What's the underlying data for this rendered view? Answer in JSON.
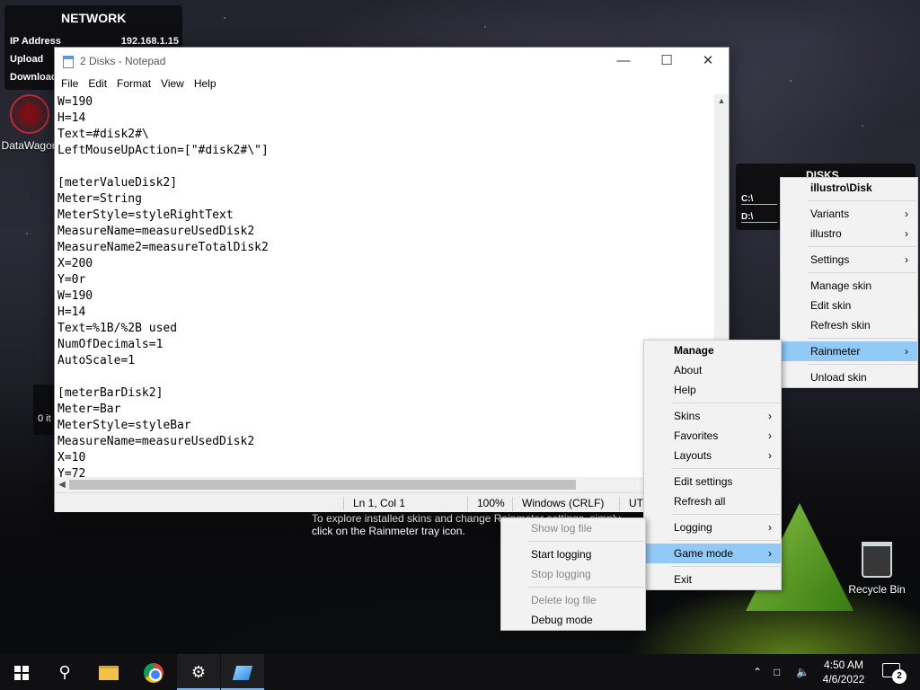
{
  "network": {
    "title": "NETWORK",
    "ip_label": "IP Address",
    "ip_value": "192.168.1.15",
    "upload_label": "Upload",
    "download_label": "Download"
  },
  "desktop": {
    "datawagon_label": "DataWagon",
    "recycle_bin_label": "Recycle Bin",
    "left_widget_text": "0 it"
  },
  "disks": {
    "title": "DISKS",
    "c_label": "C:\\",
    "d_label": "D:\\"
  },
  "tip": {
    "text": "To explore installed skins and change Rainmeter settings, simply click on the Rainmeter tray icon."
  },
  "notepad": {
    "title": "2 Disks - Notepad",
    "menu": [
      "File",
      "Edit",
      "Format",
      "View",
      "Help"
    ],
    "content": "W=190\nH=14\nText=#disk2#\\\nLeftMouseUpAction=[\"#disk2#\\\"]\n\n[meterValueDisk2]\nMeter=String\nMeterStyle=styleRightText\nMeasureName=measureUsedDisk2\nMeasureName2=measureTotalDisk2\nX=200\nY=0r\nW=190\nH=14\nText=%1B/%2B used\nNumOfDecimals=1\nAutoScale=1\n\n[meterBarDisk2]\nMeter=Bar\nMeterStyle=styleBar\nMeasureName=measureUsedDisk2\nX=10\nY=72",
    "status": {
      "position": "Ln 1, Col 1",
      "zoom": "100%",
      "line_ending": "Windows (CRLF)",
      "encoding": "UTF-8"
    }
  },
  "skin_menu": {
    "header": "illustro\\Disk",
    "items": [
      "Variants",
      "illustro",
      "Settings",
      "Manage skin",
      "Edit skin",
      "Refresh skin",
      "Rainmeter",
      "Unload skin"
    ]
  },
  "rainmeter_menu": {
    "items": [
      "Manage",
      "About",
      "Help",
      "Skins",
      "Favorites",
      "Layouts",
      "Edit settings",
      "Refresh all",
      "Logging",
      "Game mode",
      "Exit"
    ]
  },
  "logging_menu": {
    "items": [
      "Show log file",
      "Start logging",
      "Stop logging",
      "Delete log file",
      "Debug mode"
    ]
  },
  "taskbar": {
    "time": "4:50 AM",
    "date": "4/6/2022",
    "notification_count": "2",
    "icons": [
      "windows-start-icon",
      "search-icon",
      "file-explorer-icon",
      "chrome-icon",
      "settings-gear-icon",
      "notepad-icon"
    ]
  },
  "colors": {
    "menu_highlight": "#91c9f7",
    "disk_bar": "#e8b44a",
    "taskbar": "#101013"
  }
}
